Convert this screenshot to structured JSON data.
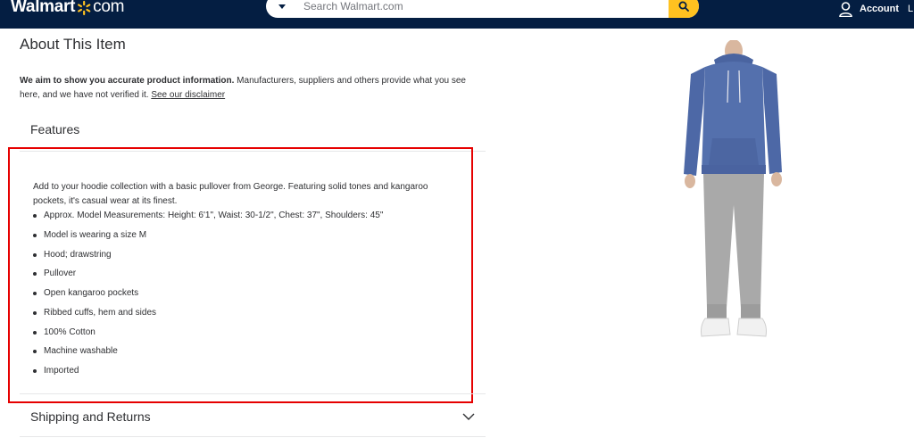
{
  "header": {
    "logo_main": "Walmart",
    "logo_suffix": "com",
    "search_placeholder": "Search Walmart.com",
    "account_label": "Account",
    "edge_char": "L"
  },
  "about": {
    "title": "About This Item",
    "disclaimer_bold": "We aim to show you accurate product information.",
    "disclaimer_text": " Manufacturers, suppliers and others provide what you see here, and we have not verified it. ",
    "disclaimer_link": "See our disclaimer"
  },
  "features": {
    "heading": "Features",
    "description": "Add to your hoodie collection with a basic pullover from George. Featuring solid tones and kangaroo pockets, it's casual wear at its finest.",
    "items": [
      "Approx. Model Measurements: Height: 6'1\", Waist: 30-1/2\", Chest: 37\", Shoulders: 45\"",
      "Model is wearing a size M",
      "Hood; drawstring",
      "Pullover",
      "Open kangaroo pockets",
      "Ribbed cuffs, hem and sides",
      "100% Cotton",
      "Machine washable",
      "Imported"
    ]
  },
  "shipping": {
    "label": "Shipping and Returns"
  },
  "colors": {
    "header_bg": "#041e42",
    "spark": "#ffc220",
    "highlight_border": "#e60000",
    "hoodie": "#5470ad",
    "pants": "#a9a9a9"
  }
}
